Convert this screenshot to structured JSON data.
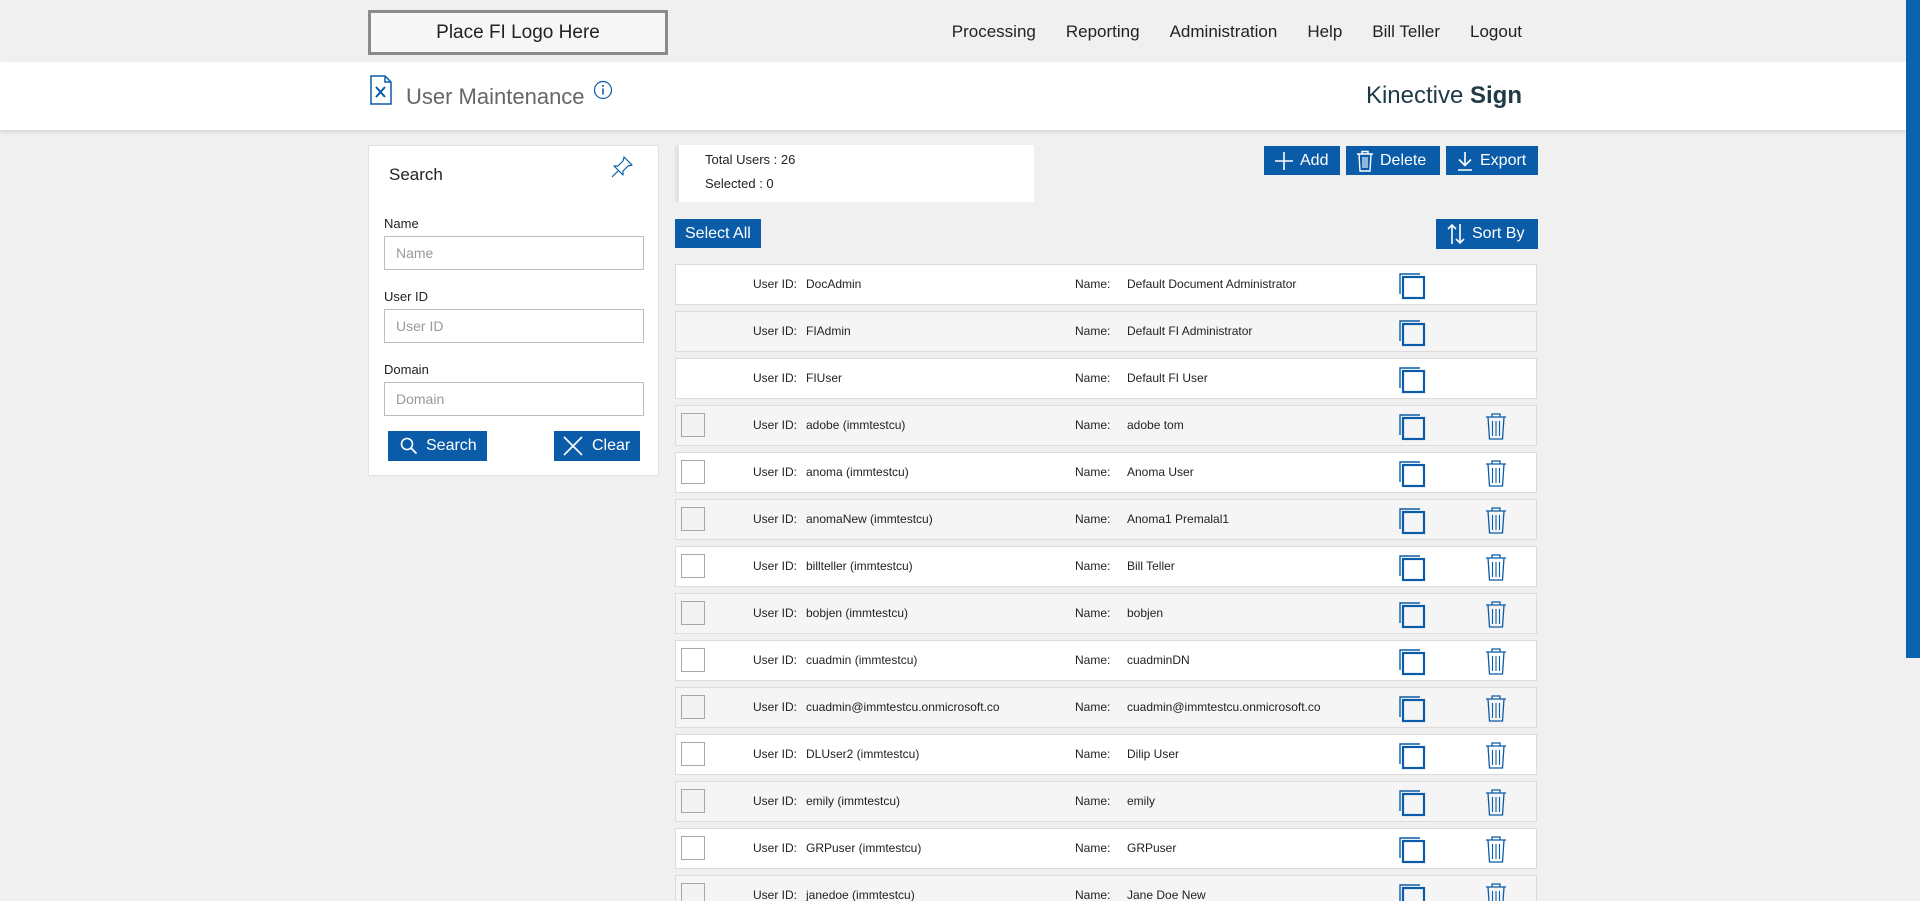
{
  "logo_placeholder": "Place FI Logo Here",
  "nav": [
    "Processing",
    "Reporting",
    "Administration",
    "Help",
    "Bill Teller",
    "Logout"
  ],
  "header": {
    "title": "User Maintenance",
    "brand_light": "Kinective",
    "brand_bold": "Sign"
  },
  "search": {
    "title": "Search",
    "name_label": "Name",
    "name_placeholder": "Name",
    "userid_label": "User ID",
    "userid_placeholder": "User ID",
    "domain_label": "Domain",
    "domain_placeholder": "Domain",
    "search_button": "Search",
    "clear_button": "Clear"
  },
  "summary": {
    "total_users": "Total Users : 26",
    "selected": "Selected : 0"
  },
  "actions": {
    "add": "Add",
    "delete": "Delete",
    "export": "Export",
    "select_all": "Select All",
    "sort_by": "Sort By"
  },
  "labels": {
    "user_id": "User ID:",
    "name": "Name:"
  },
  "colors": {
    "primary": "#0b5ca8",
    "brand_text": "#1e3a46"
  },
  "users": [
    {
      "user_id": "DocAdmin",
      "name": "Default Document Administrator",
      "selectable": false
    },
    {
      "user_id": "FIAdmin",
      "name": "Default FI Administrator",
      "selectable": false
    },
    {
      "user_id": "FIUser",
      "name": "Default FI User",
      "selectable": false
    },
    {
      "user_id": "adobe (immtestcu)",
      "name": "adobe tom",
      "selectable": true
    },
    {
      "user_id": "anoma (immtestcu)",
      "name": "Anoma User",
      "selectable": true
    },
    {
      "user_id": "anomaNew (immtestcu)",
      "name": "Anoma1 Premalal1",
      "selectable": true
    },
    {
      "user_id": "billteller (immtestcu)",
      "name": "Bill Teller",
      "selectable": true
    },
    {
      "user_id": "bobjen (immtestcu)",
      "name": "bobjen",
      "selectable": true
    },
    {
      "user_id": "cuadmin (immtestcu)",
      "name": "cuadminDN",
      "selectable": true
    },
    {
      "user_id": "cuadmin@immtestcu.onmicrosoft.co",
      "name": "cuadmin@immtestcu.onmicrosoft.co",
      "selectable": true
    },
    {
      "user_id": "DLUser2 (immtestcu)",
      "name": "Dilip User",
      "selectable": true
    },
    {
      "user_id": "emily (immtestcu)",
      "name": "emily",
      "selectable": true
    },
    {
      "user_id": "GRPuser (immtestcu)",
      "name": "GRPuser",
      "selectable": true
    },
    {
      "user_id": "janedoe (immtestcu)",
      "name": "Jane Doe New",
      "selectable": true
    }
  ]
}
